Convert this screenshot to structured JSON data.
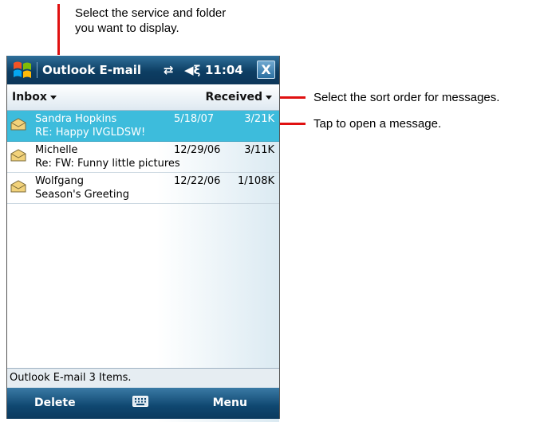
{
  "annotations": {
    "top_line1": "Select the service and folder",
    "top_line2": "you want to display.",
    "sort": "Select the sort order for messages.",
    "open": "Tap to open a message."
  },
  "titlebar": {
    "title": "Outlook E-mail",
    "time": "11:04",
    "close_glyph": "X",
    "icons": [
      "start-icon",
      "connectivity-icon",
      "volume-icon",
      "close-icon"
    ]
  },
  "header": {
    "folder": "Inbox",
    "sort": "Received"
  },
  "messages": [
    {
      "sender": "Sandra Hopkins",
      "date": "5/18/07",
      "size": "3/21K",
      "subject": "RE: Happy IVGLDSW!",
      "selected": true
    },
    {
      "sender": "Michelle",
      "date": "12/29/06",
      "size": "3/11K",
      "subject": "Re: FW: Funny little pictures",
      "selected": false
    },
    {
      "sender": "Wolfgang",
      "date": "12/22/06",
      "size": "1/108K",
      "subject": "Season's Greeting",
      "selected": false
    }
  ],
  "status": "Outlook E-mail  3 Items.",
  "softkeys": {
    "left": "Delete",
    "right": "Menu"
  },
  "colors": {
    "annotation_line": "#e01010",
    "selection": "#3dbcdc",
    "titlebar": "#0d3e63"
  }
}
